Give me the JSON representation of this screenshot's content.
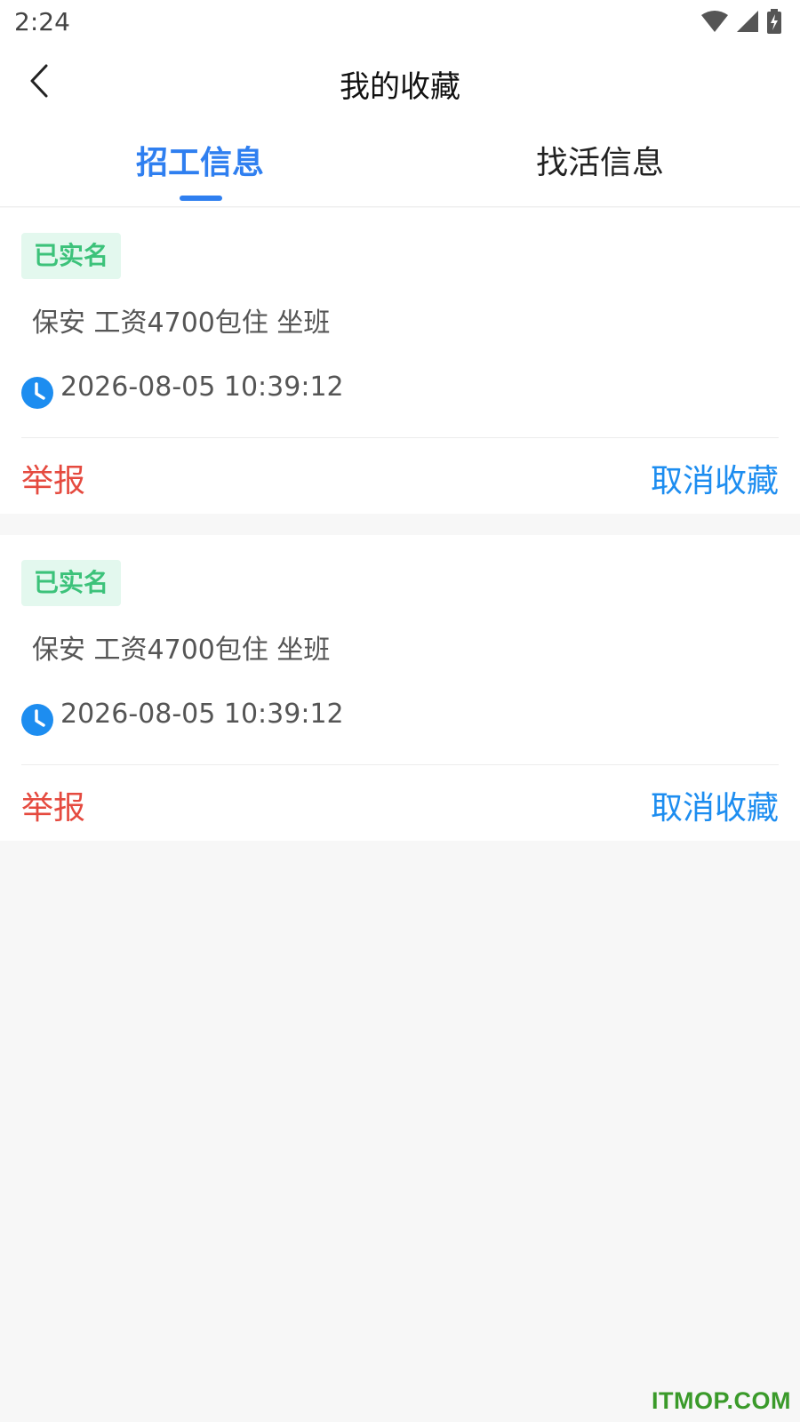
{
  "status_bar": {
    "time": "2:24",
    "icons": [
      "wifi-icon",
      "signal-icon",
      "battery-charging-icon"
    ]
  },
  "header": {
    "back_icon": "chevron-left-icon",
    "title": "我的收藏"
  },
  "tabs": [
    {
      "label": "招工信息",
      "active": true
    },
    {
      "label": "找活信息",
      "active": false
    }
  ],
  "colors": {
    "accent": "#2f7ff0",
    "report": "#e54a3f",
    "unfavorite": "#1d8df0",
    "badge_bg": "#e3f8ee",
    "badge_text": "#3cc27a"
  },
  "favorites": [
    {
      "badge": "已实名",
      "title": "保安 工资4700包住 坐班",
      "time": "2026-08-05 10:39:12",
      "report_label": "举报",
      "unfavorite_label": "取消收藏"
    },
    {
      "badge": "已实名",
      "title": "保安 工资4700包住 坐班",
      "time": "2026-08-05 10:39:12",
      "report_label": "举报",
      "unfavorite_label": "取消收藏"
    }
  ],
  "watermark": "ITMOP.COM"
}
